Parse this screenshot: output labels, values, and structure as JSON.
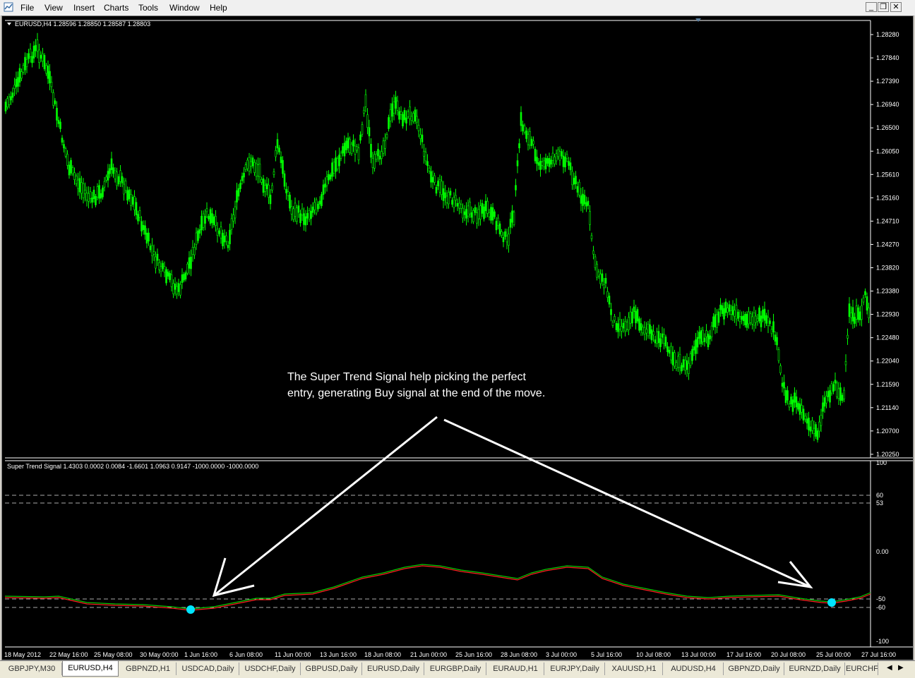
{
  "menu": [
    "File",
    "View",
    "Insert",
    "Charts",
    "Tools",
    "Window",
    "Help"
  ],
  "window_buttons": {
    "minimize": "_",
    "restore": "❐",
    "close": "✕"
  },
  "main_chart": {
    "header": "EURUSD,H4  1.28596 1.28850 1.28587 1.28803",
    "price_labels": [
      "1.28280",
      "1.27840",
      "1.27390",
      "1.26940",
      "1.26500",
      "1.26050",
      "1.25610",
      "1.25160",
      "1.24710",
      "1.24270",
      "1.23820",
      "1.23380",
      "1.22930",
      "1.22480",
      "1.22040",
      "1.21590",
      "1.21140",
      "1.20700",
      "1.20250"
    ],
    "candle_color": "#00ff00"
  },
  "annotation": {
    "line1": "The Super Trend Signal help picking the perfect",
    "line2": "entry, generating Buy signal at the end of the move."
  },
  "indicator": {
    "header": "Super Trend Signal 1.4303 0.0002 0.0084 -1.6601 1.0963 0.9147 -1000.0000 -1000.0000",
    "labels": [
      "100",
      "60",
      "53",
      "0.00",
      "-50",
      "-60",
      "-100"
    ],
    "signal_color": "#00e5ff"
  },
  "time_labels": [
    "18 May 2012",
    "22 May 16:00",
    "25 May 08:00",
    "30 May 00:00",
    "1 Jun 16:00",
    "6 Jun 08:00",
    "11 Jun 00:00",
    "13 Jun 16:00",
    "18 Jun 08:00",
    "21 Jun 00:00",
    "25 Jun 16:00",
    "28 Jun 08:00",
    "3 Jul 00:00",
    "5 Jul 16:00",
    "10 Jul 08:00",
    "13 Jul 00:00",
    "17 Jul 16:00",
    "20 Jul 08:00",
    "25 Jul 00:00",
    "27 Jul 16:00"
  ],
  "tabs": [
    "GBPJPY,M30",
    "EURUSD,H4",
    "GBPNZD,H1",
    "USDCAD,Daily",
    "USDCHF,Daily",
    "GBPUSD,Daily",
    "EURUSD,Daily",
    "EURGBP,Daily",
    "EURAUD,H1",
    "EURJPY,Daily",
    "XAUUSD,H1",
    "AUDUSD,H4",
    "GBPNZD,Daily",
    "EURNZD,Daily",
    "EURCHF"
  ],
  "active_tab": 1
}
